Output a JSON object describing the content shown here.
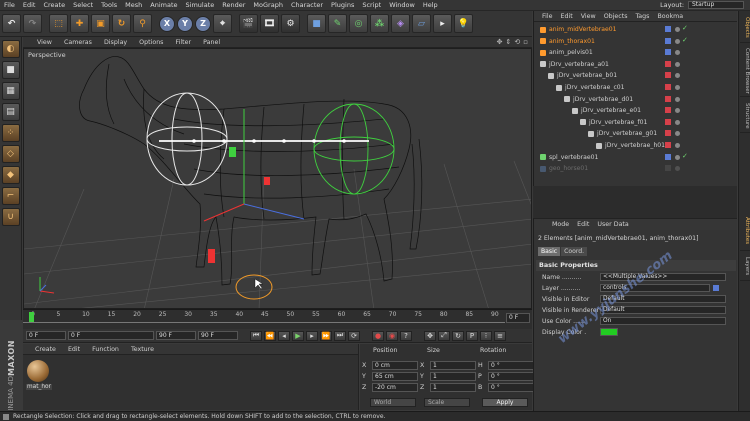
{
  "menubar": {
    "items": [
      "File",
      "Edit",
      "Create",
      "Select",
      "Tools",
      "Mesh",
      "Animate",
      "Simulate",
      "Render",
      "MoGraph",
      "Character",
      "Plugins",
      "Script",
      "Window",
      "Help"
    ],
    "layout_label": "Layout:",
    "layout_value": "Startup"
  },
  "viewport": {
    "menu": [
      "View",
      "Cameras",
      "Display",
      "Options",
      "Filter",
      "Panel"
    ],
    "label": "Perspective"
  },
  "timeline": {
    "ticks": [
      "0",
      "5",
      "10",
      "15",
      "20",
      "25",
      "30",
      "35",
      "40",
      "45",
      "50",
      "55",
      "60",
      "65",
      "70",
      "75",
      "80",
      "85",
      "90"
    ],
    "current_frame": "0 F"
  },
  "transport": {
    "start": "0 F",
    "min": "0 F",
    "max": "90 F",
    "end": "90 F"
  },
  "material_manager": {
    "menu": [
      "Create",
      "Edit",
      "Function",
      "Texture"
    ],
    "material_name": "mat_hor"
  },
  "coordinates": {
    "headers": [
      "Position",
      "Size",
      "Rotation"
    ],
    "rows": [
      {
        "axis": "X",
        "pos": "0 cm",
        "saxis": "X",
        "size": "1",
        "raxis": "H",
        "rot": "0 °"
      },
      {
        "axis": "Y",
        "pos": "65 cm",
        "saxis": "Y",
        "size": "1",
        "raxis": "P",
        "rot": "0 °"
      },
      {
        "axis": "Z",
        "pos": "-20 cm",
        "saxis": "Z",
        "size": "1",
        "raxis": "B",
        "rot": "0 °"
      }
    ],
    "world": "World",
    "scale": "Scale",
    "apply": "Apply"
  },
  "object_manager": {
    "menu": [
      "File",
      "Edit",
      "View",
      "Objects",
      "Tags",
      "Bookma"
    ],
    "objects": [
      {
        "name": "anim_midVertebrae01",
        "selected": true
      },
      {
        "name": "anim_thorax01",
        "selected": true
      },
      {
        "name": "anim_pelvis01",
        "selected": false
      },
      {
        "name": "jDrv_vertebrae_a01",
        "selected": false
      },
      {
        "name": "jDrv_vertebrae_b01",
        "selected": false
      },
      {
        "name": "jDrv_vertebrae_c01",
        "selected": false
      },
      {
        "name": "jDrv_vertebrae_d01",
        "selected": false
      },
      {
        "name": "jDrv_vertebrae_e01",
        "selected": false
      },
      {
        "name": "jDrv_vertebrae_f01",
        "selected": false
      },
      {
        "name": "jDrv_vertebrae_g01",
        "selected": false
      },
      {
        "name": "jDrv_vertebrae_h01",
        "selected": false
      },
      {
        "name": "spl_vertebrae01",
        "selected": false
      },
      {
        "name": "geo_horse01",
        "selected": false
      }
    ]
  },
  "attribute_manager": {
    "menu": [
      "Mode",
      "Edit",
      "User Data"
    ],
    "elements": "2 Elements [anim_midVertebrae01, anim_thorax01]",
    "tabs": [
      "Basic",
      "Coord."
    ],
    "section": "Basic Properties",
    "props": [
      {
        "label": "Name ..........",
        "value": "<<Multiple Values>>"
      },
      {
        "label": "Layer ..........",
        "value": "controls"
      },
      {
        "label": "Visible in Editor",
        "value": "Default"
      },
      {
        "label": "Visible in Renderer",
        "value": "Default"
      },
      {
        "label": "Use Color ......",
        "value": "On"
      },
      {
        "label": "Display Color .",
        "value": ""
      }
    ]
  },
  "side_tabs": [
    "Objects",
    "Content Browser",
    "Structure",
    "Attributes",
    "Layers"
  ],
  "branding": {
    "maxon": "MAXON",
    "product": "CINEMA 4D"
  },
  "watermark": "www.yyjunshe.com",
  "status": "Rectangle Selection: Click and drag to rectangle-select elements. Hold down SHIFT to add to the selection, CTRL to remove.",
  "colors": {
    "selected_text": "#ff9a2e",
    "display_color": "#22cc22",
    "layer_color": "#5a7bd4"
  }
}
